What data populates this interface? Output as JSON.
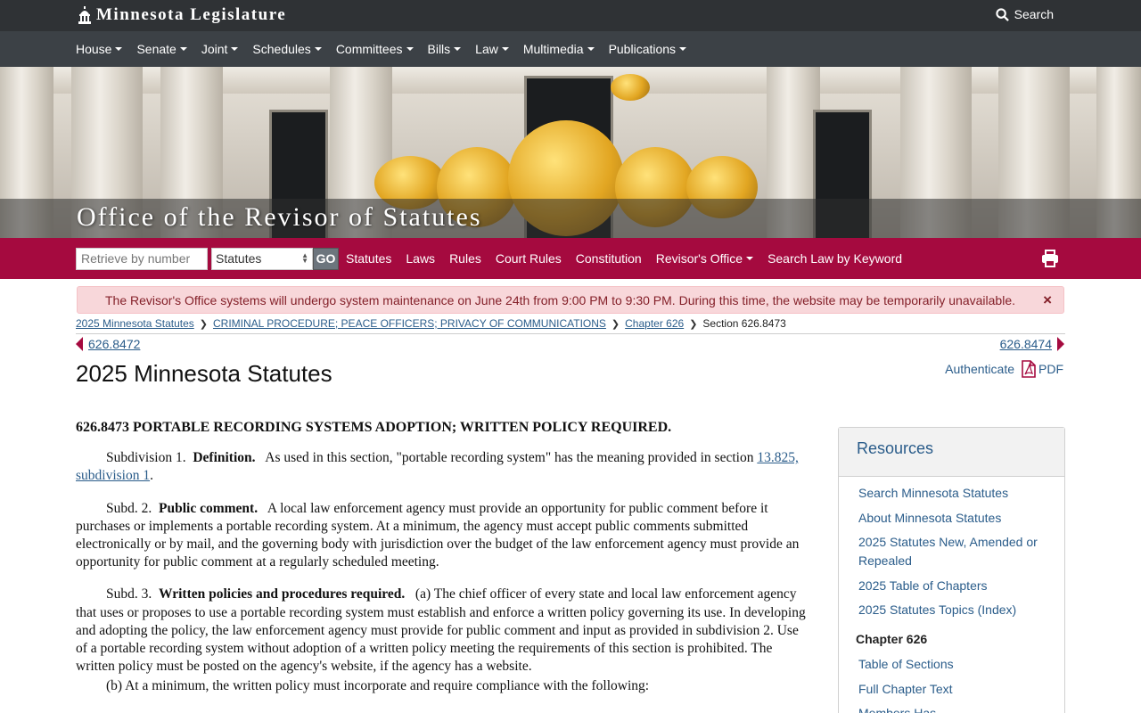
{
  "site": {
    "title": "Minnesota Legislature",
    "search_label": "Search"
  },
  "main_nav": [
    "House",
    "Senate",
    "Joint",
    "Schedules",
    "Committees",
    "Bills",
    "Law",
    "Multimedia",
    "Publications"
  ],
  "hero": {
    "title": "Office of the Revisor of Statutes"
  },
  "revisor_bar": {
    "retrieve_placeholder": "Retrieve by number",
    "type_selected": "Statutes",
    "go_label": "GO",
    "links": [
      {
        "label": "Statutes",
        "dropdown": false
      },
      {
        "label": "Laws",
        "dropdown": false
      },
      {
        "label": "Rules",
        "dropdown": false
      },
      {
        "label": "Court Rules",
        "dropdown": false
      },
      {
        "label": "Constitution",
        "dropdown": false
      },
      {
        "label": "Revisor's Office",
        "dropdown": true
      },
      {
        "label": "Search Law by Keyword",
        "dropdown": false
      }
    ]
  },
  "alert": {
    "message": "The Revisor's Office systems will undergo system maintenance on June 24th from 9:00 PM to 9:30 PM. During this time, the website may be temporarily unavailable.",
    "close": "×"
  },
  "breadcrumb": {
    "items": [
      "2025 Minnesota Statutes",
      "CRIMINAL PROCEDURE; PEACE OFFICERS; PRIVACY OF COMMUNICATIONS",
      "Chapter 626"
    ],
    "current": "Section 626.8473"
  },
  "nav": {
    "prev": "626.8472",
    "next": "626.8474"
  },
  "page": {
    "title": "2025 Minnesota Statutes",
    "authenticate": "Authenticate",
    "pdf": "PDF"
  },
  "statute": {
    "heading": "626.8473 PORTABLE RECORDING SYSTEMS ADOPTION; WRITTEN POLICY REQUIRED.",
    "subd1": {
      "label": "Subdivision 1.",
      "title": "Definition.",
      "text": "As used in this section, \"portable recording system\" has the meaning provided in section ",
      "link": "13.825, subdivision 1",
      "end": "."
    },
    "subd2": {
      "label": "Subd. 2.",
      "title": "Public comment.",
      "text": "A local law enforcement agency must provide an opportunity for public comment before it purchases or implements a portable recording system. At a minimum, the agency must accept public comments submitted electronically or by mail, and the governing body with jurisdiction over the budget of the law enforcement agency must provide an opportunity for public comment at a regularly scheduled meeting."
    },
    "subd3": {
      "label": "Subd. 3.",
      "title": "Written policies and procedures required.",
      "text": "(a) The chief officer of every state and local law enforcement agency that uses or proposes to use a portable recording system must establish and enforce a written policy governing its use. In developing and adopting the policy, the law enforcement agency must provide for public comment and input as provided in subdivision 2. Use of a portable recording system without adoption of a written policy meeting the requirements of this section is prohibited. The written policy must be posted on the agency's website, if the agency has a website.",
      "b": "(b) At a minimum, the written policy must incorporate and require compliance with the following:"
    }
  },
  "resources": {
    "title": "Resources",
    "links": [
      "Search Minnesota Statutes",
      "About Minnesota Statutes",
      "2025 Statutes New, Amended or Repealed",
      "2025 Table of Chapters",
      "2025 Statutes Topics (Index)"
    ],
    "chapter_heading": "Chapter 626",
    "chapter_links": [
      "Table of Sections",
      "Full Chapter Text",
      "Members Has..."
    ]
  },
  "colors": {
    "topbar": "#2f3235",
    "nav": "#3c4146",
    "accent": "#a50a3f",
    "link": "#2a5c8a",
    "alert_bg": "#f8d7da",
    "alert_text": "#842029"
  }
}
